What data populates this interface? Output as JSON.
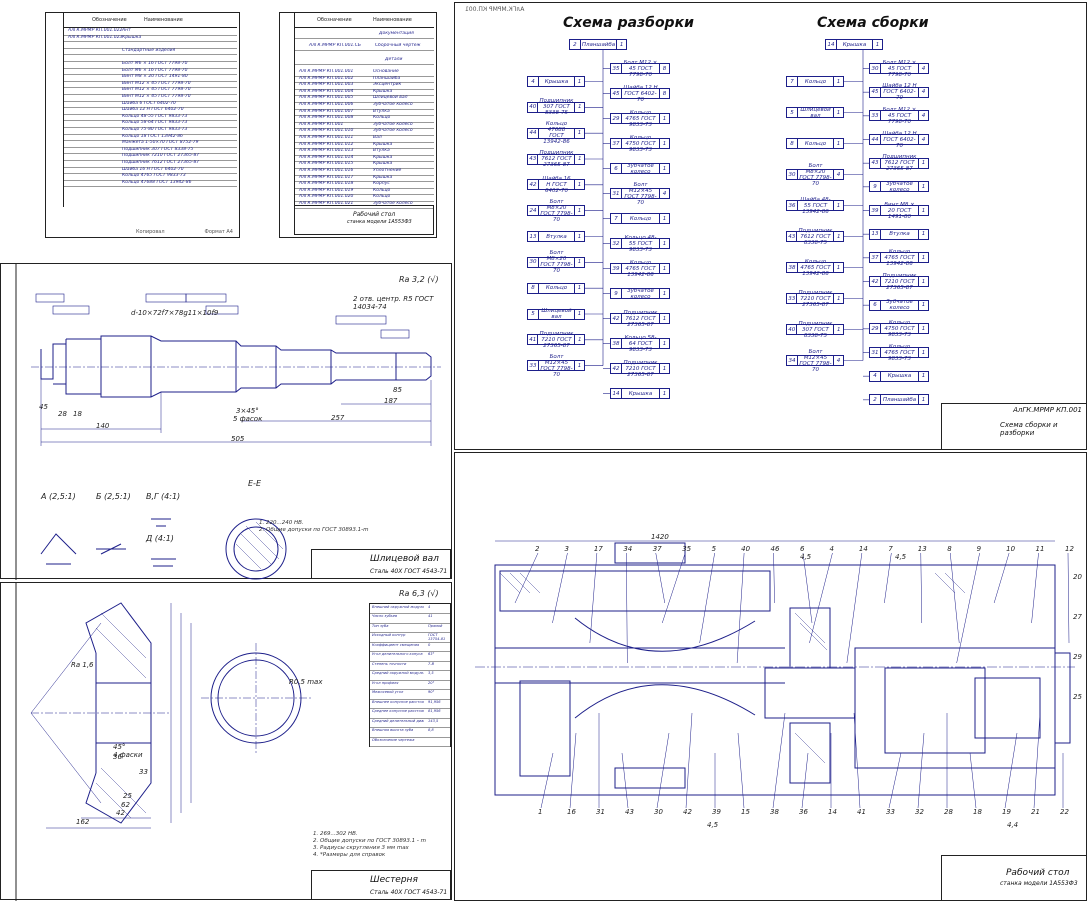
{
  "spec1": {
    "headers": [
      "Обозначение",
      "Наименование"
    ],
    "rows": [
      {
        "code": "АлГК.МРМР КП.001.022",
        "name": "Ант"
      },
      {
        "code": "АлГК.МРМР КП.001.023",
        "name": "Крышка"
      },
      {
        "code": "",
        "name": ""
      },
      {
        "code": "",
        "name": "Стандартные изделия"
      },
      {
        "code": "",
        "name": ""
      },
      {
        "code": "",
        "name": "Болт М6 × 16 ГОСТ 7798-70"
      },
      {
        "code": "",
        "name": "Болт М6 × 16 ГОСТ 7798-70"
      },
      {
        "code": "",
        "name": "Винт М8 × 20 ГОСТ 1491-80"
      },
      {
        "code": "",
        "name": "Винт М12 × 45 ГОСТ 7798-70"
      },
      {
        "code": "",
        "name": "Винт М12 × 45 ГОСТ 7798-70"
      },
      {
        "code": "",
        "name": "Винт М12 × 45 ГОСТ 7798-70"
      },
      {
        "code": "",
        "name": "Шайба 6 ГОСТ 6402-70"
      },
      {
        "code": "",
        "name": "Шайба 12 Н ГОСТ 6402-70"
      },
      {
        "code": "",
        "name": "Кольцо 48-55 ГОСТ 9833-73"
      },
      {
        "code": "",
        "name": "Кольцо 58-64 ГОСТ 9833-73"
      },
      {
        "code": "",
        "name": "Кольцо 75-80 ГОСТ 9833-73"
      },
      {
        "code": "",
        "name": "Кольцо 18 ГОСТ 13942-86"
      },
      {
        "code": "",
        "name": "Манжета 1-50×70 ГОСТ 8752-79"
      },
      {
        "code": "",
        "name": "Подшипник 307 ГОСТ 8338-75"
      },
      {
        "code": "",
        "name": "Подшипник 7210 ГОСТ 27365-87"
      },
      {
        "code": "",
        "name": "Подшипник 7612 ГОСТ 27365-87"
      },
      {
        "code": "",
        "name": "Шайба 16 Н ГОСТ 6402-70"
      },
      {
        "code": "",
        "name": "Кольцо 4765 ГОСТ 9833-73"
      },
      {
        "code": "",
        "name": "Кольцо 47688 ГОСТ 13942-86"
      }
    ],
    "footer": "Копировал",
    "format": "Формат А4"
  },
  "spec2": {
    "headers": [
      "Обозначение",
      "Наименование"
    ],
    "section_docs": "Документация",
    "doc_row": {
      "code": "АлГК.МРМР КП.001.СБ",
      "name": "Сборочный чертеж"
    },
    "section_parts": "Детали",
    "rows": [
      {
        "code": "АлГК.МРМР КП.001.001",
        "name": "Основание"
      },
      {
        "code": "АлГК.МРМР КП.001.002",
        "name": "Планшайба"
      },
      {
        "code": "АлГК.МРМР КП.001.003",
        "name": "Эксцентрик"
      },
      {
        "code": "АлГК.МРМР КП.001.004",
        "name": "Крышка"
      },
      {
        "code": "АлГК.МРМР КП.001.005",
        "name": "Шлицевой вал"
      },
      {
        "code": "АлГК.МРМР КП.001.006",
        "name": "Зубчатое колесо"
      },
      {
        "code": "АлГК.МРМР КП.001.007",
        "name": "Втулка"
      },
      {
        "code": "АлГК.МРМР КП.001.008",
        "name": "Кольцо"
      },
      {
        "code": "АлГК.МРМР КП.001",
        "name": "Зубчатое колесо"
      },
      {
        "code": "АлГК.МРМР КП.001.010",
        "name": "Зубчатое колесо"
      },
      {
        "code": "АлГК.МРМР КП.001.011",
        "name": "Вал"
      },
      {
        "code": "АлГК.МРМР КП.001.012",
        "name": "Крышка"
      },
      {
        "code": "АлГК.МРМР КП.001.013",
        "name": "Втулка"
      },
      {
        "code": "АлГК.МРМР КП.001.014",
        "name": "Крышка"
      },
      {
        "code": "АлГК.МРМР КП.001.015",
        "name": "Крышка"
      },
      {
        "code": "АлГК.МРМР КП.001.016",
        "name": "Уплотнение"
      },
      {
        "code": "АлГК.МРМР КП.001.017",
        "name": "Крышка"
      },
      {
        "code": "АлГК.МРМР КП.001.018",
        "name": "Корпус"
      },
      {
        "code": "АлГК.МРМР КП.001.019",
        "name": "Кольцо"
      },
      {
        "code": "АлГК.МРМР КП.001.020",
        "name": "Кольцо"
      },
      {
        "code": "АлГК.МРМР КП.001.021",
        "name": "Зубчатое колесо"
      }
    ],
    "title_block": {
      "name": "Рабочий стол",
      "sub": "станка модели 1А553Ф3"
    },
    "footer": "Копировал",
    "format": "Формат А4"
  },
  "shaft": {
    "roughness": "Ra 3,2 (√)",
    "note_centers": "2 отв. центр. R5 ГОСТ 14034-74",
    "spline_callout": "d-10×72f7×78g11×10f9",
    "views": [
      "А (2,5:1)",
      "Б (2,5:1)",
      "В,Г (4:1)",
      "Д (4:1)",
      "Е-Е"
    ],
    "dims": [
      "140",
      "505",
      "257",
      "187",
      "85",
      "28",
      "18",
      "45",
      "3×45°",
      "5 фасок"
    ],
    "notes": [
      "1. 220...240 НВ.",
      "2. Общие допуски по ГОСТ 30893.1-m"
    ],
    "title_block": {
      "name": "Шлицевой вал",
      "material": "Сталь 40Х ГОСТ 4543-71"
    }
  },
  "gear": {
    "roughness": "Ra 6,3 (√)",
    "params": [
      "Внешний окружной модуль",
      "Число зубьев",
      "Тип зуба",
      "Исходный контур",
      "Коэффициент смещения",
      "Угол делительного конуса",
      "Степень точности",
      "Средний окружной модуль",
      "Угол профиля",
      "Межосевой угол",
      "Внешнее конусное расстояние",
      "Среднее конусное расстояние",
      "Средний делительный диаметр",
      "Внешняя высота зуба",
      "Обозначение чертежа"
    ],
    "values": [
      "4",
      "41",
      "Прямой",
      "ГОСТ 13754-81",
      "0",
      "63°",
      "7-В",
      "3,5",
      "20°",
      "90°",
      "91,956",
      "81,956",
      "143,5",
      "8,8",
      ""
    ],
    "notes": [
      "1. 269...302 НВ.",
      "2. Общие допуски по ГОСТ 30893.1 - m",
      "3. Радиусы скругления 3 мм max",
      "4. *Размеры для справок"
    ],
    "dims": [
      "162",
      "42",
      "62",
      "25",
      "36",
      "33",
      "45°",
      "4 фаски",
      "R0,5 max",
      "Ra 1,6"
    ],
    "title_block": {
      "name": "Шестерня",
      "material": "Сталь 40Х ГОСТ 4543-71"
    }
  },
  "scheme": {
    "stamp": "АлГК.МРМР КП.001",
    "title_left": "Схема разборки",
    "title_right": "Схема сборки",
    "left_top": {
      "n": "2",
      "t": "Планшайба",
      "q": "1"
    },
    "right_top": {
      "n": "14",
      "t": "Крышка",
      "q": "1"
    },
    "left_main": [
      {
        "n": "4",
        "t": "Крышка",
        "q": "1"
      },
      {
        "n": "40",
        "t": "Подшипник 307 ГОСТ 8338-75",
        "q": "1"
      },
      {
        "n": "44",
        "t": "Кольцо 47688 ГОСТ 13942-86",
        "q": "1"
      },
      {
        "n": "43",
        "t": "Подшипник 7612 ГОСТ 27365-87",
        "q": "1"
      },
      {
        "n": "42",
        "t": "Шайба 16 Н ГОСТ 6402-70",
        "q": "1"
      },
      {
        "n": "24",
        "t": "Болт М8×20 ГОСТ 7798-70",
        "q": "1"
      },
      {
        "n": "13",
        "t": "Втулка",
        "q": "1"
      },
      {
        "n": "30",
        "t": "Болт М8×20 ГОСТ 7798-70",
        "q": "1"
      },
      {
        "n": "8",
        "t": "Кольцо",
        "q": "1"
      },
      {
        "n": "5",
        "t": "Шлицевой вал",
        "q": "1"
      },
      {
        "n": "41",
        "t": "Подшипник 7210 ГОСТ 27365-87",
        "q": "1"
      },
      {
        "n": "33",
        "t": "Болт М12×45 ГОСТ 7798-70",
        "q": "1"
      }
    ],
    "left_sub": [
      {
        "n": "35",
        "t": "Болт М12 × 45 ГОСТ 7798-70",
        "q": "8"
      },
      {
        "n": "45",
        "t": "Шайба 12 Н ГОСТ 6402-70",
        "q": "8"
      },
      {
        "n": "29",
        "t": "Кольцо 4765 ГОСТ 9833-73",
        "q": "1"
      },
      {
        "n": "37",
        "t": "Кольцо 4750 ГОСТ 9833-73",
        "q": "1"
      },
      {
        "n": "6",
        "t": "Зубчатое колесо",
        "q": "1"
      },
      {
        "n": "31",
        "t": "Болт М12×45 ГОСТ 7798-70",
        "q": "4"
      },
      {
        "n": "7",
        "t": "Кольцо",
        "q": "1"
      },
      {
        "n": "32",
        "t": "Кольцо 48-55 ГОСТ 9833-73",
        "q": "1"
      },
      {
        "n": "39",
        "t": "Кольцо 4765 ГОСТ 13942-86",
        "q": "1"
      },
      {
        "n": "9",
        "t": "Зубчатое колесо",
        "q": "1"
      },
      {
        "n": "42",
        "t": "Подшипник 7612 ГОСТ 27365-87",
        "q": "1"
      },
      {
        "n": "38",
        "t": "Кольцо 58-64 ГОСТ 9833-73",
        "q": "1"
      },
      {
        "n": "42",
        "t": "Подшипник 7210 ГОСТ 27365-87",
        "q": "1"
      },
      {
        "n": "14",
        "t": "Крышка",
        "q": "1"
      }
    ],
    "right_main": [
      {
        "n": "7",
        "t": "Кольцо",
        "q": "1"
      },
      {
        "n": "5",
        "t": "Шлицевой вал",
        "q": "1"
      },
      {
        "n": "8",
        "t": "Кольцо",
        "q": "1"
      },
      {
        "n": "30",
        "t": "Болт М8×20 ГОСТ 7798-70",
        "q": "4"
      },
      {
        "n": "36",
        "t": "Шайба 48-55 ГОСТ 13942-86",
        "q": "1"
      },
      {
        "n": "43",
        "t": "Подшипник 7612 ГОСТ 8338-75",
        "q": "1"
      },
      {
        "n": "38",
        "t": "Кольцо 4765 ГОСТ 13942-86",
        "q": "1"
      },
      {
        "n": "33",
        "t": "Подшипник 7210 ГОСТ 27365-87",
        "q": "1"
      },
      {
        "n": "40",
        "t": "Подшипник 307 ГОСТ 8338-75",
        "q": "1"
      },
      {
        "n": "34",
        "t": "Болт М12×45 ГОСТ 7798-70",
        "q": "4"
      }
    ],
    "right_sub": [
      {
        "n": "30",
        "t": "Болт М12 × 45 ГОСТ 7798-70",
        "q": "4"
      },
      {
        "n": "45",
        "t": "Шайба 12 Н ГОСТ 6402-70",
        "q": "4"
      },
      {
        "n": "33",
        "t": "Болт М12 × 45 ГОСТ 7798-70",
        "q": "4"
      },
      {
        "n": "44",
        "t": "Шайба 12 Н ГОСТ 6402-70",
        "q": "4"
      },
      {
        "n": "43",
        "t": "Подшипник 7612 ГОСТ 27365-87",
        "q": "1"
      },
      {
        "n": "9",
        "t": "Зубчатое колесо",
        "q": "1"
      },
      {
        "n": "39",
        "t": "Винт М8 × 20 ГОСТ 1491-80",
        "q": "1"
      },
      {
        "n": "13",
        "t": "Втулка",
        "q": "1"
      },
      {
        "n": "37",
        "t": "Кольцо 4765 ГОСТ 13942-86",
        "q": "1"
      },
      {
        "n": "42",
        "t": "Подшипник 7210 ГОСТ 27365-87",
        "q": "1"
      },
      {
        "n": "6",
        "t": "Зубчатое колесо",
        "q": "1"
      },
      {
        "n": "29",
        "t": "Кольцо 4750 ГОСТ 9833-73",
        "q": "1"
      },
      {
        "n": "31",
        "t": "Кольцо 4765 ГОСТ 9833-73",
        "q": "1"
      },
      {
        "n": "4",
        "t": "Крышка",
        "q": "1"
      },
      {
        "n": "2",
        "t": "Планшайба",
        "q": "1"
      }
    ],
    "title_block": {
      "code": "АлГК.МРМР КП.001",
      "name": "Схема сборки и разборки"
    }
  },
  "assembly": {
    "top_callouts": [
      "2",
      "3",
      "17",
      "34",
      "37",
      "35",
      "5",
      "40",
      "46",
      "6",
      "4",
      "14",
      "7",
      "13",
      "8",
      "9",
      "10",
      "11",
      "12"
    ],
    "bottom_callouts": [
      "1",
      "16",
      "31",
      "43",
      "30",
      "42",
      "39",
      "15",
      "38",
      "36",
      "14",
      "41",
      "33",
      "32",
      "28",
      "18",
      "19",
      "21",
      "22"
    ],
    "side_callouts": [
      "20",
      "27",
      "29",
      "25"
    ],
    "fractions": [
      "4,5",
      "4,5",
      "4,4",
      "4,5"
    ],
    "dim_top": "1420",
    "title_block": {
      "name": "Рабочий стол",
      "sub": "станка модели 1А553Ф3"
    }
  },
  "colors": {
    "ink": "#1d1f8a",
    "frame": "#222222",
    "paper": "#ffffff"
  }
}
